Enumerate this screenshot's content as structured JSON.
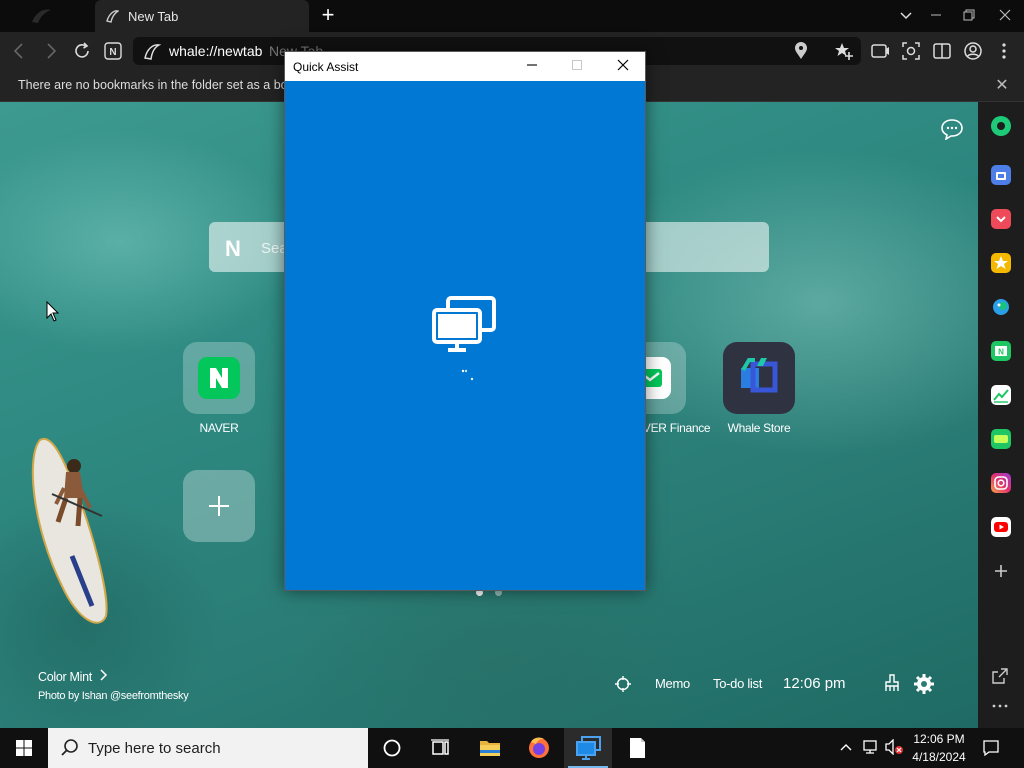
{
  "browser": {
    "tab_title": "New Tab",
    "url": "whale://newtab",
    "url_ghost": "New Tab",
    "bookmark_notice": "There are no bookmarks in the folder set as a bookmarks bar"
  },
  "ntp": {
    "search_placeholder": "Search",
    "search_logo": "N",
    "tiles": [
      {
        "label": "NAVER",
        "icon": "naver-icon"
      },
      {
        "label": "NAVER Finance",
        "icon": "naver-finance-icon"
      },
      {
        "label": "Whale Store",
        "icon": "whale-store-icon"
      }
    ],
    "add_tile": "+",
    "theme_name": "Color Mint",
    "photo_credit": "Photo by Ishan @seefromthesky",
    "memo": "Memo",
    "todo": "To-do list",
    "clock": "12:06 pm"
  },
  "quick_assist": {
    "title": "Quick Assist",
    "state": "loading"
  },
  "sidebar": {
    "icons": [
      "green-dot-icon",
      "briefcase-icon",
      "pocket-icon",
      "star-icon",
      "papago-icon",
      "naver-news-icon",
      "stock-chart-icon",
      "webtoon-icon",
      "instagram-icon",
      "youtube-icon",
      "add-icon",
      "open-external-icon",
      "more-icon"
    ]
  },
  "taskbar": {
    "search_placeholder": "Type here to search",
    "time": "12:06 PM",
    "date": "4/18/2024"
  },
  "colors": {
    "quick_assist_blue": "#0078d4",
    "naver_green": "#03c75a",
    "chrome_dark": "#232323"
  }
}
